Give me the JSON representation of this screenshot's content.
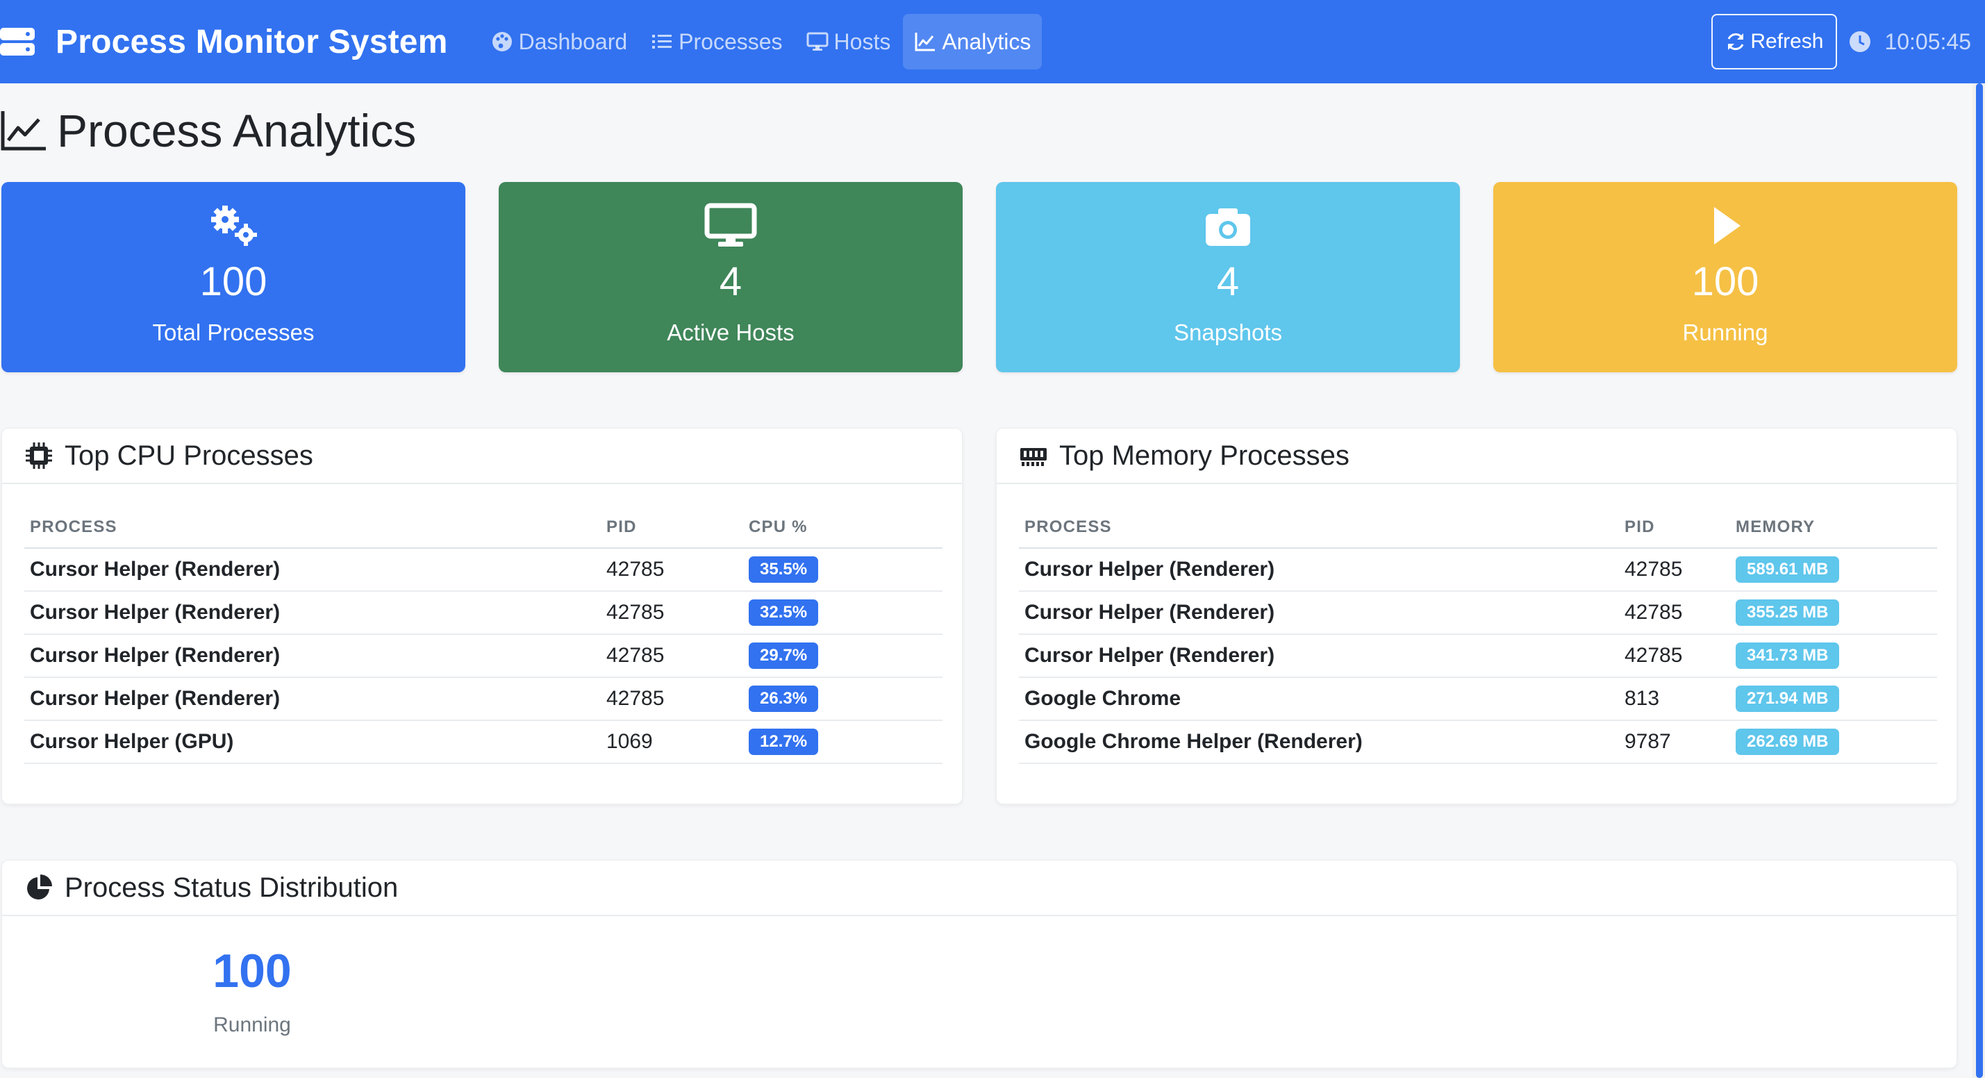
{
  "app": {
    "title": "Process Monitor System"
  },
  "nav": {
    "items": [
      {
        "label": "Dashboard",
        "icon": "palette-icon",
        "active": false
      },
      {
        "label": "Processes",
        "icon": "list-icon",
        "active": false
      },
      {
        "label": "Hosts",
        "icon": "desktop-icon",
        "active": false
      },
      {
        "label": "Analytics",
        "icon": "chart-line-icon",
        "active": true
      }
    ],
    "refresh_label": "Refresh",
    "time": "10:05:45"
  },
  "page": {
    "title": "Process Analytics"
  },
  "stats": [
    {
      "value": "100",
      "label": "Total Processes",
      "icon": "cogs-icon",
      "color": "#3272f0"
    },
    {
      "value": "4",
      "label": "Active Hosts",
      "icon": "desktop-icon",
      "color": "#3f8659"
    },
    {
      "value": "4",
      "label": "Snapshots",
      "icon": "camera-icon",
      "color": "#5fc6ec"
    },
    {
      "value": "100",
      "label": "Running",
      "icon": "play-icon",
      "color": "#f5c044"
    }
  ],
  "cpu": {
    "title": "Top CPU Processes",
    "columns": [
      "PROCESS",
      "PID",
      "CPU %"
    ],
    "rows": [
      {
        "process": "Cursor Helper (Renderer)",
        "pid": "42785",
        "value": "35.5%"
      },
      {
        "process": "Cursor Helper (Renderer)",
        "pid": "42785",
        "value": "32.5%"
      },
      {
        "process": "Cursor Helper (Renderer)",
        "pid": "42785",
        "value": "29.7%"
      },
      {
        "process": "Cursor Helper (Renderer)",
        "pid": "42785",
        "value": "26.3%"
      },
      {
        "process": "Cursor Helper (GPU)",
        "pid": "1069",
        "value": "12.7%"
      }
    ]
  },
  "memory": {
    "title": "Top Memory Processes",
    "columns": [
      "PROCESS",
      "PID",
      "MEMORY"
    ],
    "rows": [
      {
        "process": "Cursor Helper (Renderer)",
        "pid": "42785",
        "value": "589.61 MB"
      },
      {
        "process": "Cursor Helper (Renderer)",
        "pid": "42785",
        "value": "355.25 MB"
      },
      {
        "process": "Cursor Helper (Renderer)",
        "pid": "42785",
        "value": "341.73 MB"
      },
      {
        "process": "Google Chrome",
        "pid": "813",
        "value": "271.94 MB"
      },
      {
        "process": "Google Chrome Helper (Renderer)",
        "pid": "9787",
        "value": "262.69 MB"
      }
    ]
  },
  "status": {
    "title": "Process Status Distribution",
    "value": "100",
    "label": "Running"
  },
  "colors": {
    "primary": "#3272f0",
    "success": "#3f8659",
    "info": "#5fc6ec",
    "warning": "#f5c044"
  }
}
